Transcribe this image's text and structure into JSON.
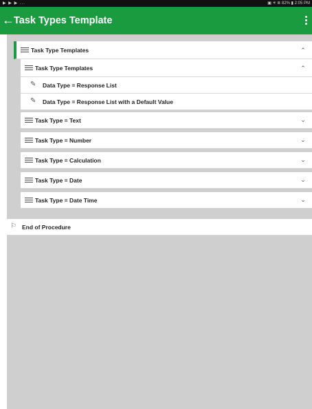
{
  "status_bar": {
    "left_icons": "▶ ▶ ▶ ...",
    "right_text": "▣ ✳ ≣ 82% ▮ 2:05 PM"
  },
  "app_bar": {
    "back_icon": "arrow-left-icon",
    "title": "Task Types Template",
    "menu_icon": "overflow-menu-icon",
    "color": "#1a9b3f"
  },
  "accent_color": "#1a9b3f",
  "tree": {
    "section": {
      "label": "Task Type Templates",
      "expanded": true
    },
    "subsection": {
      "label": "Task Type Templates",
      "expanded": true,
      "items": [
        {
          "label": "Data Type = Response List"
        },
        {
          "label": "Data Type = Response List with a Default Value"
        }
      ]
    },
    "task_types": [
      {
        "label": "Task Type = Text",
        "expanded": false
      },
      {
        "label": "Task Type = Number",
        "expanded": false
      },
      {
        "label": "Task Type = Calculation",
        "expanded": false
      },
      {
        "label": "Task Type = Date",
        "expanded": false
      },
      {
        "label": "Task Type = Date Time",
        "expanded": false
      }
    ],
    "end": {
      "label": "End of Procedure"
    }
  }
}
